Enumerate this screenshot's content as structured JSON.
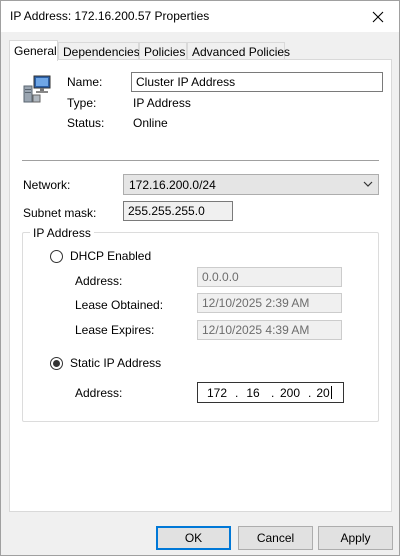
{
  "window": {
    "title": "IP Address: 172.16.200.57 Properties"
  },
  "tabs": [
    {
      "label": "General"
    },
    {
      "label": "Dependencies"
    },
    {
      "label": "Policies"
    },
    {
      "label": "Advanced Policies"
    }
  ],
  "general": {
    "name_label": "Name:",
    "name_value": "Cluster IP Address",
    "type_label": "Type:",
    "type_value": "IP Address",
    "status_label": "Status:",
    "status_value": "Online",
    "network_label": "Network:",
    "network_value": "172.16.200.0/24",
    "subnet_label": "Subnet mask:",
    "subnet_value": "255.255.255.0",
    "ip_group_label": "IP Address",
    "dhcp_label": "DHCP Enabled",
    "dhcp_selected": false,
    "dhcp_address_label": "Address:",
    "dhcp_address_value": "0.0.0.0",
    "lease_obtained_label": "Lease Obtained:",
    "lease_obtained_value": "12/10/2025 2:39 AM",
    "lease_expires_label": "Lease Expires:",
    "lease_expires_value": "12/10/2025 4:39 AM",
    "static_label": "Static IP Address",
    "static_selected": true,
    "static_address_label": "Address:",
    "static_octets": [
      "172",
      "16",
      "200",
      "20"
    ]
  },
  "buttons": {
    "ok": "OK",
    "cancel": "Cancel",
    "apply": "Apply"
  },
  "icons": {
    "close": "close-icon",
    "resource": "cluster-resource-icon",
    "dropdown": "chevron-down-icon"
  },
  "colors": {
    "default_button_border": "#0078d7",
    "window_bg": "#f0f0f0",
    "panel_bg": "#ffffff"
  }
}
